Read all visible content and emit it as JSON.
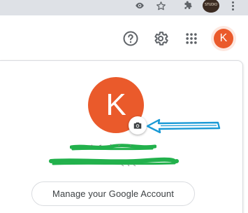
{
  "browser_toolbar": {
    "icons": [
      "eye-icon",
      "star-icon",
      "puzzle-icon"
    ],
    "extension_avatar_text": "STUDIO",
    "menu_icon": "more-vert-icon"
  },
  "header": {
    "help_icon": "help-circle-icon",
    "settings_icon": "gear-icon",
    "apps_icon": "apps-grid-icon",
    "account_initial": "K"
  },
  "account_panel": {
    "avatar_initial": "K",
    "camera_icon": "camera-icon",
    "name_redacted": "",
    "email_redacted": "",
    "manage_button_label": "Manage your Google Account"
  },
  "colors": {
    "avatar_bg": "#ea5a2b",
    "annotation_arrow": "#1a9ad6",
    "redaction": "#22b14c"
  }
}
